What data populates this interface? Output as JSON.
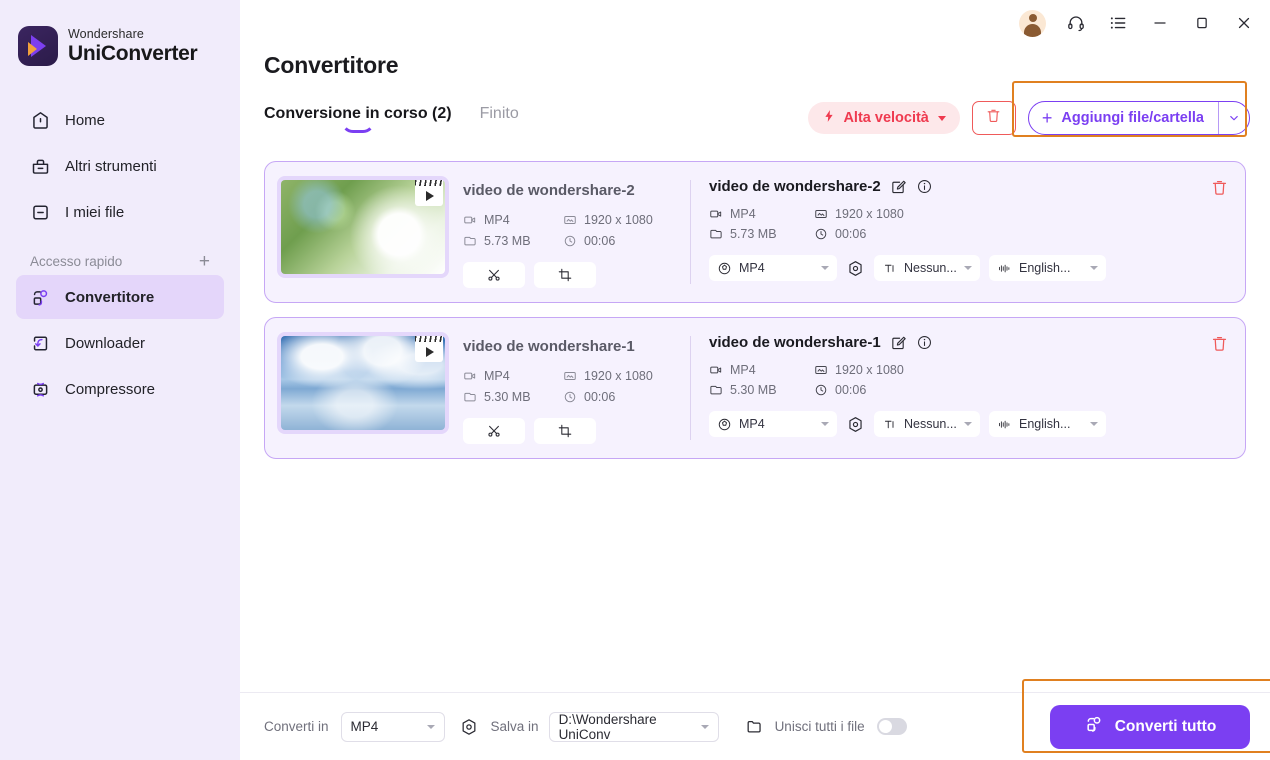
{
  "app": {
    "brand_top": "Wondershare",
    "brand_bottom": "UniConverter"
  },
  "titlebar": {
    "avatar": "avatar-icon",
    "support": "headset-icon",
    "menu": "list-menu-icon",
    "minimize": "minimize-icon",
    "maximize": "maximize-icon",
    "close": "close-icon"
  },
  "sidebar": {
    "items": [
      {
        "label": "Home",
        "icon": "home-icon",
        "active": false
      },
      {
        "label": "Altri strumenti",
        "icon": "toolbox-icon",
        "active": false
      },
      {
        "label": "I miei file",
        "icon": "files-icon",
        "active": false
      }
    ],
    "quick_access": {
      "label": "Accesso rapido",
      "add": "+"
    },
    "quick_items": [
      {
        "label": "Convertitore",
        "icon": "converter-icon",
        "active": true
      },
      {
        "label": "Downloader",
        "icon": "download-icon",
        "active": false
      },
      {
        "label": "Compressore",
        "icon": "compress-icon",
        "active": false
      }
    ]
  },
  "page": {
    "title": "Convertitore"
  },
  "tabs": [
    {
      "label": "Conversione in corso (2)",
      "active": true
    },
    {
      "label": "Finito",
      "active": false
    }
  ],
  "toolbar": {
    "speed_label": "Alta velocità",
    "speed_color": "#ef3a4f",
    "delete_all": "trash-icon",
    "add_label": "Aggiungi file/cartella",
    "add_plus": "+",
    "accent_color": "#7b3ff2",
    "highlight_color": "#e08020"
  },
  "files": [
    {
      "source_name": "video de wondershare-2",
      "thumb": "green-foliage-sunlight",
      "source_meta": {
        "format": "MP4",
        "resolution": "1920 x 1080",
        "size": "5.73 MB",
        "duration": "00:06"
      },
      "tools": [
        {
          "name": "trim-button",
          "icon": "scissors-icon"
        },
        {
          "name": "crop-button",
          "icon": "crop-icon"
        }
      ],
      "output_name": "video de wondershare-2",
      "output_meta": {
        "format": "MP4",
        "resolution": "1920 x 1080",
        "size": "5.73 MB",
        "duration": "00:06"
      },
      "format_select": "MP4",
      "subtitle_select": "Nessun...",
      "audio_select": "English..."
    },
    {
      "source_name": "video de wondershare-1",
      "thumb": "blue-sky-water-reflection",
      "source_meta": {
        "format": "MP4",
        "resolution": "1920 x 1080",
        "size": "5.30 MB",
        "duration": "00:06"
      },
      "tools": [
        {
          "name": "trim-button",
          "icon": "scissors-icon"
        },
        {
          "name": "crop-button",
          "icon": "crop-icon"
        }
      ],
      "output_name": "video de wondershare-1",
      "output_meta": {
        "format": "MP4",
        "resolution": "1920 x 1080",
        "size": "5.30 MB",
        "duration": "00:06"
      },
      "format_select": "MP4",
      "subtitle_select": "Nessun...",
      "audio_select": "English..."
    }
  ],
  "bottombar": {
    "convert_to_label": "Converti in",
    "convert_to_value": "MP4",
    "save_in_label": "Salva in",
    "save_in_value": "D:\\Wondershare UniConv",
    "merge_label": "Unisci tutti i file",
    "merge_on": false,
    "convert_all_label": "Converti tutto"
  }
}
